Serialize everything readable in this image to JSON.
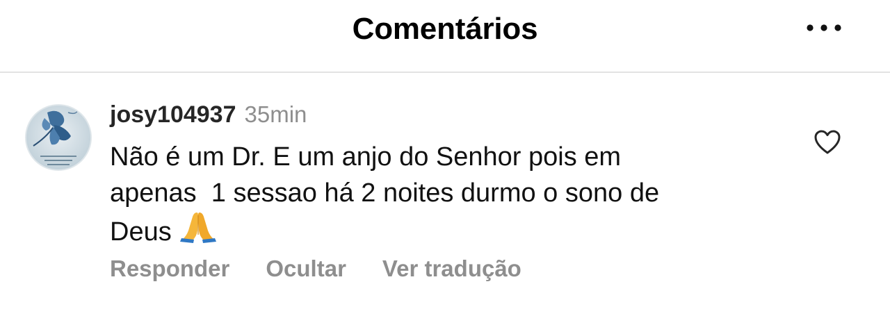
{
  "header": {
    "title": "Comentários",
    "more_icon": "more-horizontal-icon"
  },
  "comment": {
    "username": "josy104937",
    "timestamp": "35min",
    "text": "Não é um Dr. E um anjo do Senhor pois em\napenas  1 sessao há 2 noites durmo o sono de\nDeus",
    "emoji": "folded-hands-emoji",
    "avatar_icon": "blue-flower-avatar",
    "like_icon": "heart-outline-icon",
    "actions": [
      "Responder",
      "Ocultar",
      "Ver tradução"
    ]
  },
  "colors": {
    "secondary_text": "#8e8e8e",
    "divider": "#e3e3e3",
    "primary_text": "#262626"
  }
}
